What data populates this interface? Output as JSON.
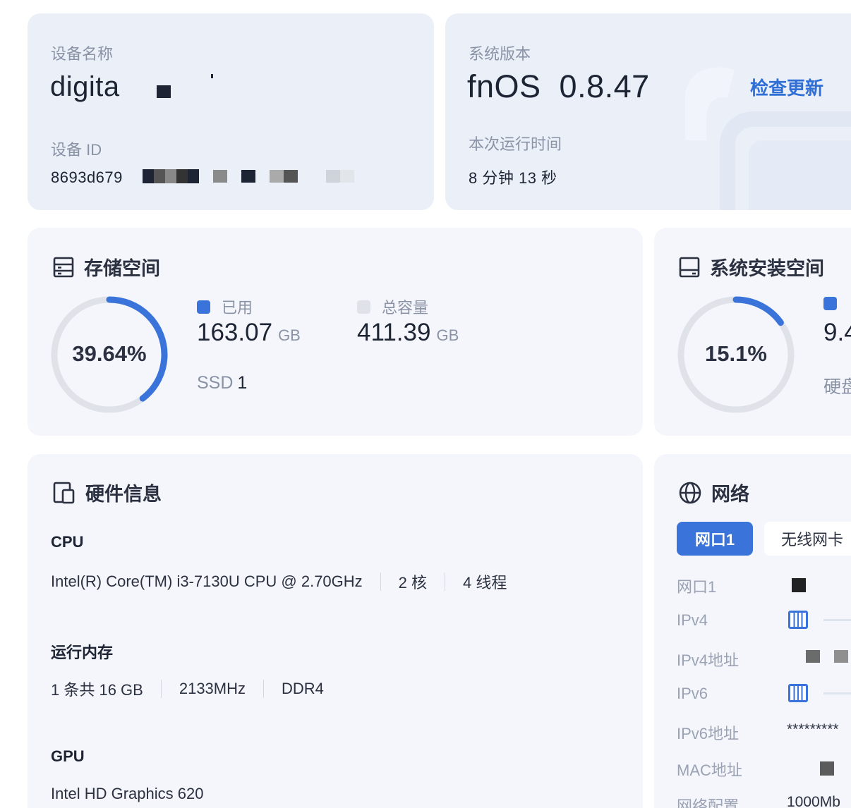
{
  "device": {
    "name_label": "设备名称",
    "name_value": "digita",
    "id_label": "设备 ID",
    "id_value": "8693d679"
  },
  "system": {
    "version_label": "系统版本",
    "version_value": "fnOS  0.8.47",
    "check_update": "检查更新",
    "uptime_label": "本次运行时间",
    "uptime_value": "8 分钟 13 秒"
  },
  "storage": {
    "title": "存储空间",
    "percent_text": "39.64%",
    "used_fraction": 0.3964,
    "used_label": "已用",
    "used_value": "163.07",
    "used_unit": "GB",
    "total_label": "总容量",
    "total_value": "411.39",
    "total_unit": "GB",
    "ssd_label": "SSD",
    "ssd_count": "1",
    "colors": {
      "used": "#3a73d9",
      "total": "#dfe2e8"
    }
  },
  "sysdisk": {
    "title": "系统安装空间",
    "percent_text": "15.1%",
    "used_fraction": 0.151,
    "value_partial": "9.4",
    "disk_partial": "硬盘"
  },
  "hardware": {
    "title": "硬件信息",
    "cpu_head": "CPU",
    "cpu_model": "Intel(R) Core(TM) i3-7130U CPU @ 2.70GHz",
    "cpu_cores": "2 核",
    "cpu_threads": "4 线程",
    "mem_head": "运行内存",
    "mem_count": "1 条共 16 GB",
    "mem_speed": "2133MHz",
    "mem_type": "DDR4",
    "gpu_head": "GPU",
    "gpu_model": "Intel HD Graphics 620"
  },
  "network": {
    "title": "网络",
    "tabs": [
      "网口1",
      "无线网卡"
    ],
    "rows": [
      {
        "label": "网口1",
        "value": ""
      },
      {
        "label": "IPv4",
        "value": ""
      },
      {
        "label": "IPv4地址",
        "value": ""
      },
      {
        "label": "IPv6",
        "value": ""
      },
      {
        "label": "IPv6地址",
        "value": "*********"
      },
      {
        "label": "MAC地址",
        "value": ""
      },
      {
        "label": "网络配置",
        "value": "1000Mb"
      }
    ]
  }
}
